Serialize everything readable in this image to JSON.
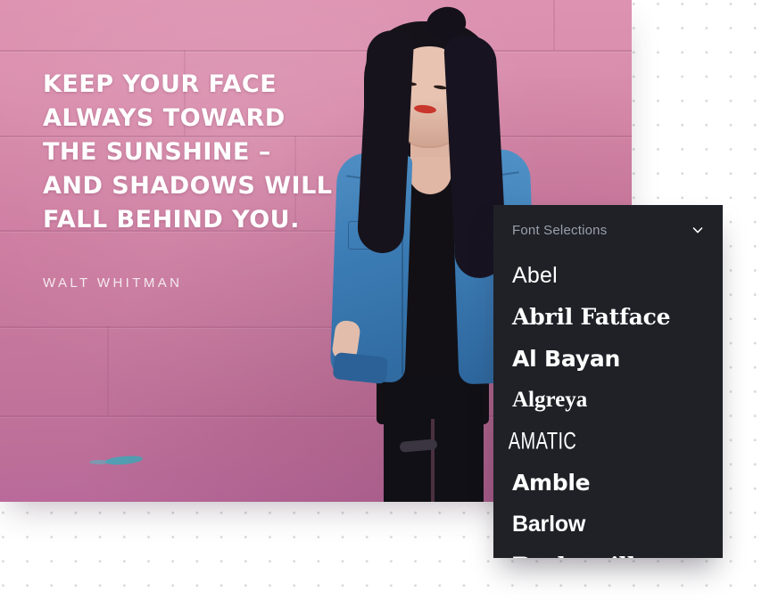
{
  "quote": {
    "text": "Keep your face always toward the sunshine – and shadows will fall behind you.",
    "author": "Walt Whitman"
  },
  "photo": {
    "alt": "Smiling woman in denim jacket against a pink brick wall",
    "wall_color": "#cd7ca0",
    "jacket_color": "#3d7db6"
  },
  "font_panel": {
    "title": "Font Selections",
    "collapse_icon": "chevron-down-icon",
    "background_color": "#1f2127",
    "title_color": "#9aa0aa",
    "item_color": "#ffffff",
    "items": [
      {
        "label": "Abel"
      },
      {
        "label": "Abril Fatface"
      },
      {
        "label": "Al Bayan"
      },
      {
        "label": "Algreya"
      },
      {
        "label": "Amatic"
      },
      {
        "label": "Amble"
      },
      {
        "label": "Barlow"
      },
      {
        "label": "Baskerville"
      }
    ]
  },
  "background": {
    "color": "#ffffff",
    "dot_color": "#d8d8d8"
  }
}
